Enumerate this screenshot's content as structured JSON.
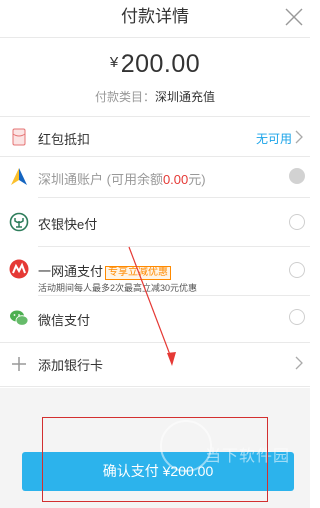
{
  "header": {
    "title": "付款详情"
  },
  "payment": {
    "currency_symbol": "¥",
    "amount": "200.00",
    "category_label": "付款类目：",
    "category_value": "深圳通充值"
  },
  "rows": {
    "hongbao": {
      "label": "红包抵扣",
      "link": "无可用"
    },
    "account": {
      "label_prefix": "深圳通账户 (可用余额",
      "balance": "0.00",
      "label_suffix": "元)"
    },
    "abc": {
      "label": "农银快e付"
    },
    "yiwangtong": {
      "label": "一网通支付",
      "badge": "专享立减优惠",
      "sub": "活动期间每人最多2次最高立减30元优惠"
    },
    "wechat": {
      "label": "微信支付"
    },
    "add_card": {
      "label": "添加银行卡"
    }
  },
  "confirm": {
    "label": "确认支付 ¥200.00"
  },
  "watermark": {
    "text": "当下软件园"
  },
  "colors": {
    "accent": "#2cb3ec",
    "link": "#1aa3e8",
    "highlight": "#e53935",
    "badge": "#ff8a00"
  }
}
